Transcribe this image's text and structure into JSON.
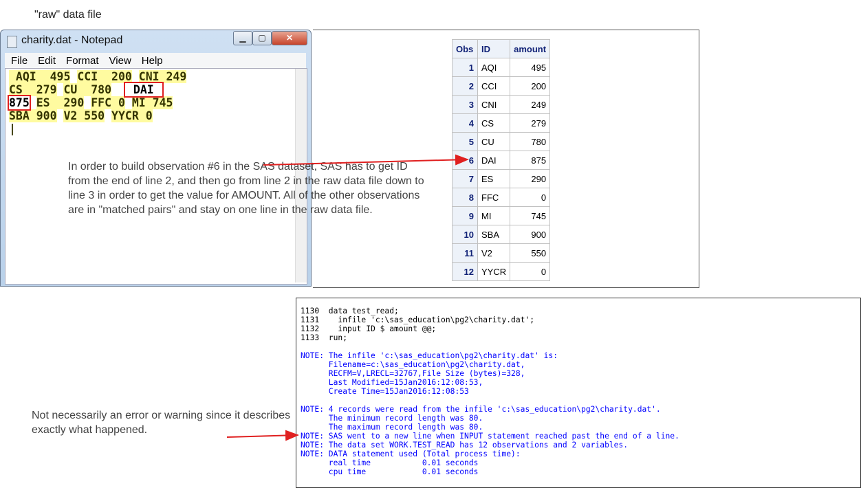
{
  "raw_label": "\"raw\" data file",
  "notepad": {
    "title": "charity.dat - Notepad",
    "buttons": {
      "minimize": "▁",
      "maximize": "▢",
      "close": "✕"
    },
    "menu": [
      "File",
      "Edit",
      "Format",
      "View",
      "Help"
    ],
    "lines": [
      [
        " AQI  495",
        " ",
        "CCI  200",
        " ",
        "CNI 249"
      ],
      [
        "CS  279",
        " ",
        "CU  780",
        "  ",
        "DAI"
      ],
      [
        "875",
        "ES  290",
        " ",
        "FFC 0",
        " ",
        "MI 745"
      ],
      [
        "SBA 900",
        " ",
        "V2 550",
        " ",
        "YYCR 0"
      ]
    ]
  },
  "annotation1": "In order to build observation #6  in the SAS dataset, SAS has to get ID from the end of line 2, and then go from line 2 in the raw data file down to line 3 in order to get the value for AMOUNT. All of the other observations are in \"matched pairs\" and stay on one line in the raw data file.",
  "table": {
    "headers": [
      "Obs",
      "ID",
      "amount"
    ],
    "rows": [
      [
        "1",
        "AQI",
        "495"
      ],
      [
        "2",
        "CCI",
        "200"
      ],
      [
        "3",
        "CNI",
        "249"
      ],
      [
        "4",
        "CS",
        "279"
      ],
      [
        "5",
        "CU",
        "780"
      ],
      [
        "6",
        "DAI",
        "875"
      ],
      [
        "7",
        "ES",
        "290"
      ],
      [
        "8",
        "FFC",
        "0"
      ],
      [
        "9",
        "MI",
        "745"
      ],
      [
        "10",
        "SBA",
        "900"
      ],
      [
        "11",
        "V2",
        "550"
      ],
      [
        "12",
        "YYCR",
        "0"
      ]
    ]
  },
  "log": {
    "lines": [
      {
        "t": "1130  data test_read;",
        "c": "blk"
      },
      {
        "t": "1131    infile 'c:\\sas_education\\pg2\\charity.dat';",
        "c": "blk"
      },
      {
        "t": "1132    input ID $ amount @@;",
        "c": "blk"
      },
      {
        "t": "1133  run;",
        "c": "blk"
      },
      {
        "t": "",
        "c": "blk"
      },
      {
        "t": "NOTE: The infile 'c:\\sas_education\\pg2\\charity.dat' is:",
        "c": "blu"
      },
      {
        "t": "      Filename=c:\\sas_education\\pg2\\charity.dat,",
        "c": "blu"
      },
      {
        "t": "      RECFM=V,LRECL=32767,File Size (bytes)=328,",
        "c": "blu"
      },
      {
        "t": "      Last Modified=15Jan2016:12:08:53,",
        "c": "blu"
      },
      {
        "t": "      Create Time=15Jan2016:12:08:53",
        "c": "blu"
      },
      {
        "t": "",
        "c": "blu"
      },
      {
        "t": "NOTE: 4 records were read from the infile 'c:\\sas_education\\pg2\\charity.dat'.",
        "c": "blu"
      },
      {
        "t": "      The minimum record length was 80.",
        "c": "blu"
      },
      {
        "t": "      The maximum record length was 80.",
        "c": "blu"
      },
      {
        "t": "NOTE: SAS went to a new line when INPUT statement reached past the end of a line.",
        "c": "blu"
      },
      {
        "t": "NOTE: The data set WORK.TEST_READ has 12 observations and 2 variables.",
        "c": "blu"
      },
      {
        "t": "NOTE: DATA statement used (Total process time):",
        "c": "blu"
      },
      {
        "t": "      real time           0.01 seconds",
        "c": "blu"
      },
      {
        "t": "      cpu time            0.01 seconds",
        "c": "blu"
      }
    ]
  },
  "annotation2": "Not necessarily an error or warning since it describes exactly what happened.",
  "colors": {
    "highlight": "#fffba0",
    "arrow": "#e02020",
    "note": "#0000ff",
    "table_header": "#edf2f9"
  }
}
